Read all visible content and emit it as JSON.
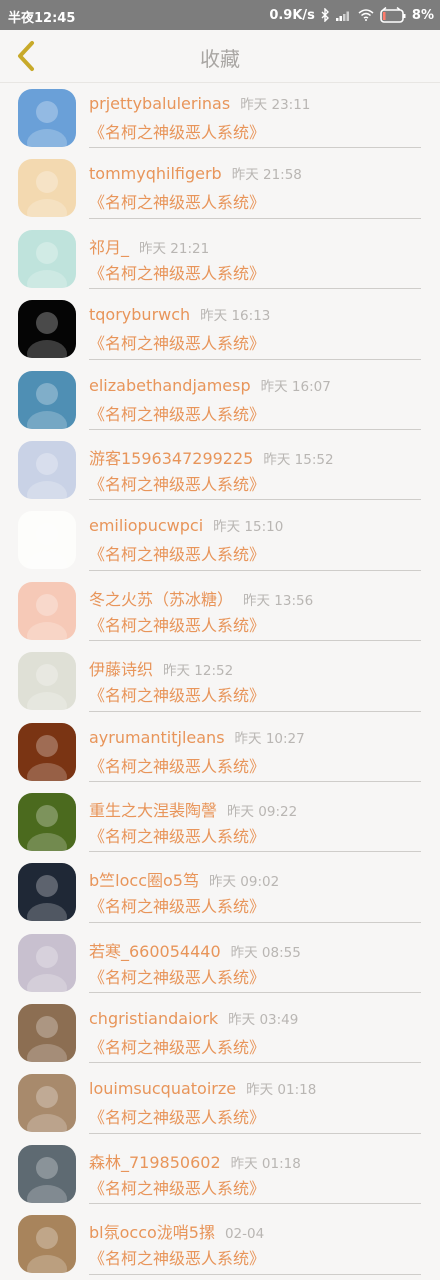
{
  "status_bar": {
    "time": "半夜12:45",
    "speed": "0.9K/s",
    "battery": "8%"
  },
  "header": {
    "title": "收藏"
  },
  "favorites": [
    {
      "user": "prjettybalulerinas",
      "time": "昨天 23:11",
      "title": "《名柯之神级恶人系统》",
      "avatar_color": "#6aa0d8"
    },
    {
      "user": "tommyqhilfigerb",
      "time": "昨天 21:58",
      "title": "《名柯之神级恶人系统》",
      "avatar_color": "#f3d9b0"
    },
    {
      "user": "祁月_",
      "time": "昨天 21:21",
      "title": "《名柯之神级恶人系统》",
      "avatar_color": "#bfe3dc"
    },
    {
      "user": "tqoryburwch",
      "time": "昨天 16:13",
      "title": "《名柯之神级恶人系统》",
      "avatar_color": "#050505"
    },
    {
      "user": "elizabethandjamesp",
      "time": "昨天 16:07",
      "title": "《名柯之神级恶人系统》",
      "avatar_color": "#4f8fb4"
    },
    {
      "user": "游客1596347299225",
      "time": "昨天 15:52",
      "title": "《名柯之神级恶人系统》",
      "avatar_color": "#c9d2e6"
    },
    {
      "user": "emiliopucwpci",
      "time": "昨天 15:10",
      "title": "《名柯之神级恶人系统》",
      "avatar_color": "#fdfdfb"
    },
    {
      "user": "冬之火苏（苏冰糖）",
      "time": "昨天 13:56",
      "title": "《名柯之神级恶人系统》",
      "avatar_color": "#f6c9b7"
    },
    {
      "user": "伊藤诗织",
      "time": "昨天 12:52",
      "title": "《名柯之神级恶人系统》",
      "avatar_color": "#dfe0d6"
    },
    {
      "user": "ayrumantitjleans",
      "time": "昨天 10:27",
      "title": "《名柯之神级恶人系统》",
      "avatar_color": "#7a3413"
    },
    {
      "user": "重生之大涅裴陶謦",
      "time": "昨天 09:22",
      "title": "《名柯之神级恶人系统》",
      "avatar_color": "#4b6a1e"
    },
    {
      "user": "b竺locc圈o5笃",
      "time": "昨天 09:02",
      "title": "《名柯之神级恶人系统》",
      "avatar_color": "#1f2836"
    },
    {
      "user": "若寒_660054440",
      "time": "昨天 08:55",
      "title": "《名柯之神级恶人系统》",
      "avatar_color": "#c8c0cf"
    },
    {
      "user": "chgristiandaiork",
      "time": "昨天 03:49",
      "title": "《名柯之神级恶人系统》",
      "avatar_color": "#8c6e52"
    },
    {
      "user": "louimsucquatoirze",
      "time": "昨天 01:18",
      "title": "《名柯之神级恶人系统》",
      "avatar_color": "#a88a6c"
    },
    {
      "user": "森林_719850602",
      "time": "昨天 01:18",
      "title": "《名柯之神级恶人系统》",
      "avatar_color": "#5e6a72"
    },
    {
      "user": "bl氛occo泷哨5摞",
      "time": "02-04",
      "title": "《名柯之神级恶人系统》",
      "avatar_color": "#a8845c"
    }
  ],
  "icons": {
    "back": "chevron-left-icon",
    "bluetooth": "bluetooth-icon",
    "signal": "signal-icon",
    "wifi": "wifi-icon",
    "battery": "battery-icon"
  },
  "colors": {
    "accent": "#e8955a",
    "back_arrow": "#c8aa2a",
    "title_gray": "#a9a6a3",
    "status_bar": "#7d7d7d"
  }
}
